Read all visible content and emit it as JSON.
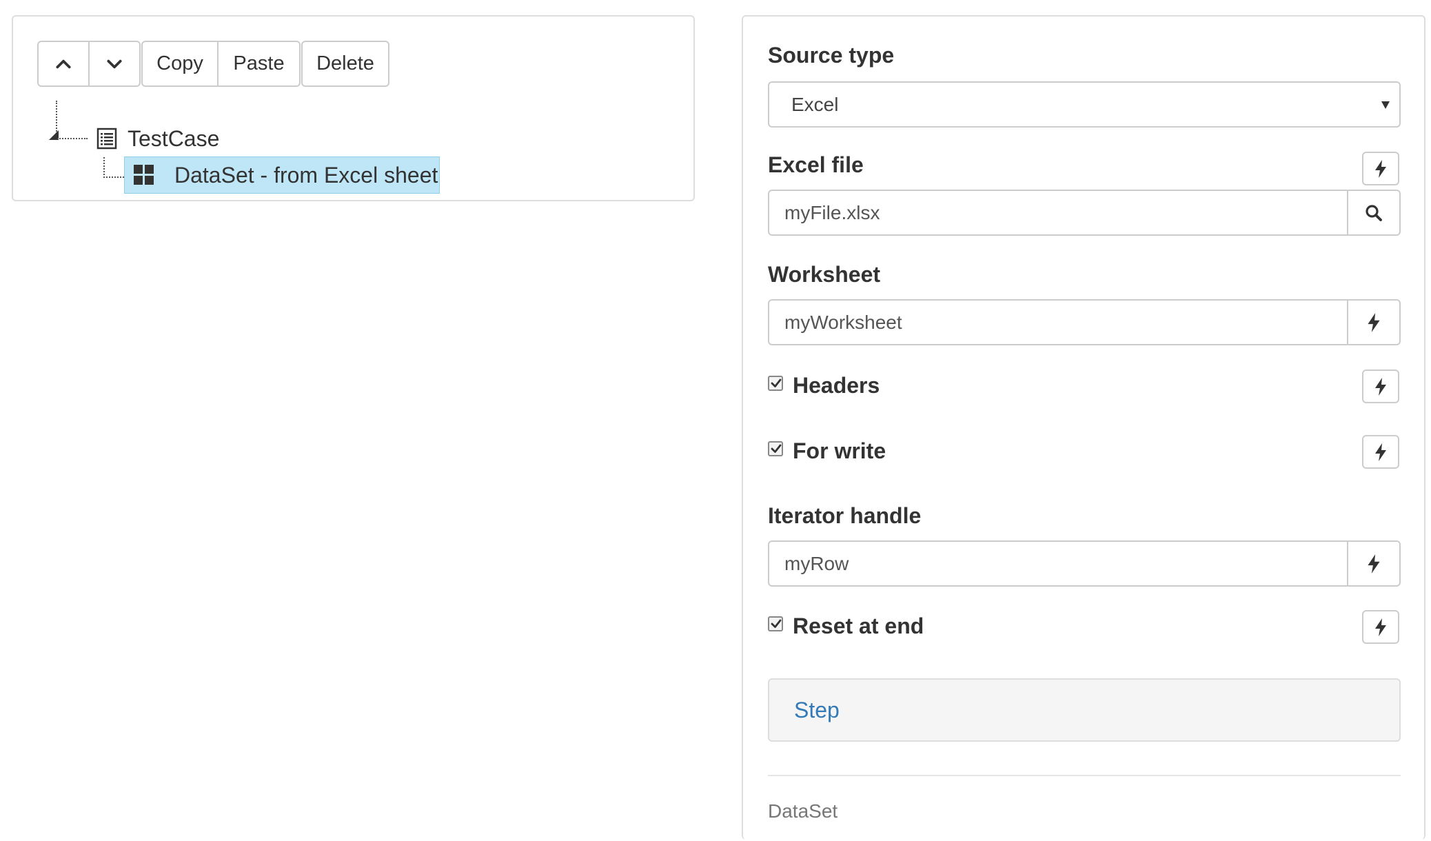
{
  "toolbar": {
    "up_icon": "chevron-up-icon",
    "down_icon": "chevron-down-icon",
    "copy_label": "Copy",
    "paste_label": "Paste",
    "delete_label": "Delete"
  },
  "tree": {
    "root": {
      "label": "TestCase",
      "icon": "list-icon"
    },
    "child": {
      "label": "DataSet - from Excel sheet",
      "icon": "grid-icon",
      "selected": true
    }
  },
  "form": {
    "source_type": {
      "label": "Source type",
      "value": "Excel"
    },
    "excel_file": {
      "label": "Excel file",
      "value": "myFile.xlsx",
      "addon_icon": "search-icon"
    },
    "worksheet": {
      "label": "Worksheet",
      "value": "myWorksheet",
      "addon_icon": "bolt-icon"
    },
    "headers": {
      "label": "Headers",
      "checked": true
    },
    "for_write": {
      "label": "For write",
      "checked": true
    },
    "iterator_handle": {
      "label": "Iterator handle",
      "value": "myRow",
      "addon_icon": "bolt-icon"
    },
    "reset_at_end": {
      "label": "Reset at end",
      "checked": true
    },
    "step_link": "Step",
    "footer": "DataSet"
  },
  "colors": {
    "selected_bg": "#bfe6f7",
    "link": "#337ab7",
    "border": "#cccccc"
  }
}
